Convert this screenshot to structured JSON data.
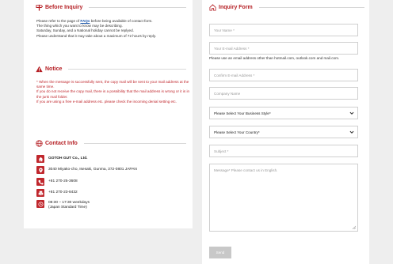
{
  "before": {
    "title": "Before Inquiry",
    "line1_pre": "Please refer to the page of ",
    "line1_link": "FAQs",
    "line1_post": " before being available of contact form.",
    "line2": "The thing which you want to know may be describing.",
    "line3": "Saturday, Sunday, and a National holiday cannot be replyed.",
    "line4": "Please understand that it may take about a maximum of 72 hours by reply."
  },
  "notice": {
    "title": "Notice",
    "p1": "* When the message is successfully sent, the copy mail will be sent to your mail address at the same time.",
    "p2": "If you do not receive the copy mail, there is a possibility that the mail address is wrong or it is in the junk mail folder.",
    "p3": "If you are using a free e-mail address etc. please check the incoming denial setting etc."
  },
  "contact": {
    "title": "Contact Info",
    "company": "GOTOH GUT Co., Ltd.",
    "address": "3040 Miyako-cho, Isesaki, Gunma, 372-0801 JAPAN",
    "phone": "+81 270-25-3608",
    "fax": "+81 270-23-8432",
    "hours1": "08:30 – 17:30 weekdays",
    "hours2": "(Japan Standard Time)"
  },
  "form": {
    "title": "Inquiry Form",
    "name_ph": "Your Name *",
    "email_ph": "Your E-mail Address *",
    "email_note": "Please use an email address other than hotmail.com, outlook.com and mail.com.",
    "confirm_ph": "Confirm E-mail Address *",
    "company_ph": "Company Name",
    "business_style": "Please Select Your Business Style*",
    "country": "Please Select Your Country*",
    "subject_ph": "Subject *",
    "message_ph": "Message*   Please contact us in English.",
    "send": "Send"
  },
  "colors": {
    "accent": "#b51f24"
  }
}
